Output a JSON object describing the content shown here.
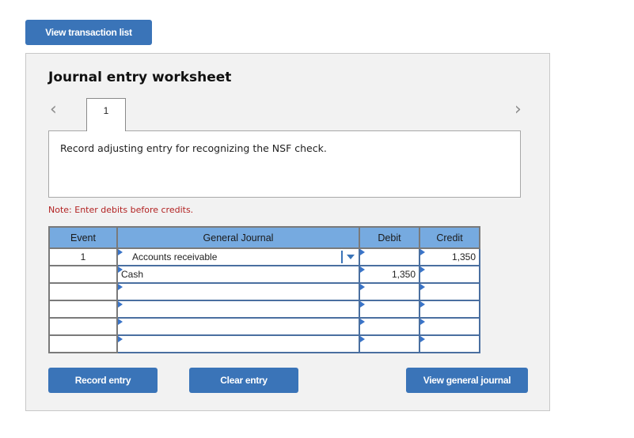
{
  "header": {
    "view_transaction_list": "View transaction list"
  },
  "worksheet": {
    "title": "Journal entry worksheet",
    "prev_icon": "chevron-left-icon",
    "next_icon": "chevron-right-icon",
    "tabs": [
      {
        "label": "1"
      }
    ],
    "description": "Record adjusting entry for recognizing the NSF check.",
    "note": "Note: Enter debits before credits."
  },
  "table": {
    "columns": [
      "Event",
      "General Journal",
      "Debit",
      "Credit"
    ],
    "rows": [
      {
        "event": "1",
        "account": "Accounts receivable",
        "debit": "",
        "credit": "1,350"
      },
      {
        "event": "",
        "account": "Cash",
        "debit": "1,350",
        "credit": ""
      },
      {
        "event": "",
        "account": "",
        "debit": "",
        "credit": ""
      },
      {
        "event": "",
        "account": "",
        "debit": "",
        "credit": ""
      },
      {
        "event": "",
        "account": "",
        "debit": "",
        "credit": ""
      },
      {
        "event": "",
        "account": "",
        "debit": "",
        "credit": ""
      }
    ]
  },
  "buttons": {
    "record_entry": "Record entry",
    "clear_entry": "Clear entry",
    "view_general_journal": "View general journal"
  },
  "colors": {
    "button": "#3a74b8",
    "header": "#76aae0",
    "note": "#b22222"
  }
}
